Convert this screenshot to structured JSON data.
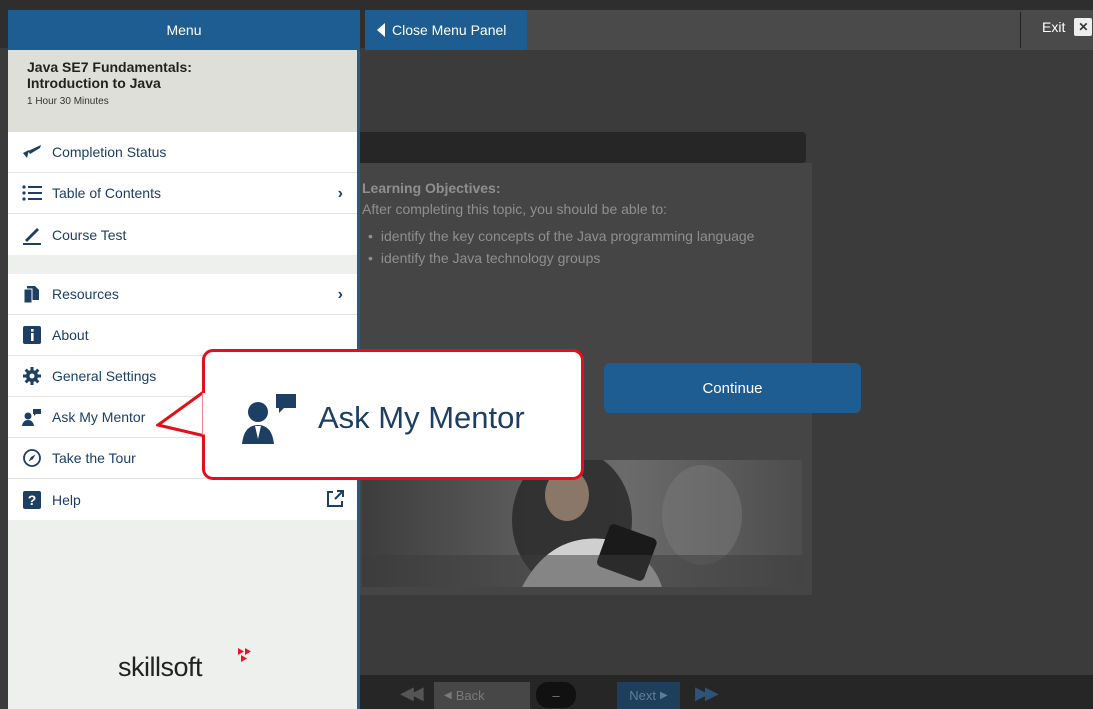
{
  "topbar": {
    "menu_title": "Menu",
    "close_panel_label": "Close Menu Panel",
    "exit_label": "Exit",
    "exit_icon": "close-icon"
  },
  "course": {
    "title_line1": "Java SE7 Fundamentals:",
    "title_line2": "Introduction to Java",
    "duration": "1 Hour 30 Minutes"
  },
  "menu": {
    "group1": [
      {
        "label": "Completion Status",
        "icon": "completion-check-icon"
      },
      {
        "label": "Table of Contents",
        "icon": "list-icon",
        "chevron": "›"
      },
      {
        "label": "Course Test",
        "icon": "pencil-icon"
      }
    ],
    "group2": [
      {
        "label": "Resources",
        "icon": "documents-icon",
        "chevron": "›"
      },
      {
        "label": "About",
        "icon": "info-icon"
      },
      {
        "label": "General Settings",
        "icon": "gear-icon"
      },
      {
        "label": "Ask My Mentor",
        "icon": "mentor-icon"
      },
      {
        "label": "Take the Tour",
        "icon": "compass-icon"
      },
      {
        "label": "Help",
        "icon": "help-icon",
        "external": true
      }
    ]
  },
  "logo": {
    "text": "skillsoft"
  },
  "callout": {
    "label": "Ask My Mentor"
  },
  "content": {
    "objectives_title": "Learning Objectives:",
    "objectives_intro": "After completing this topic, you should be able to:",
    "objectives": [
      "identify the key concepts of the Java programming language",
      "identify the Java technology groups"
    ],
    "continue_label": "Continue"
  },
  "nav": {
    "back_label": "Back",
    "page_indicator": "–",
    "next_label": "Next"
  },
  "colors": {
    "brand_blue": "#1e5d91",
    "callout_red": "#e30f1b",
    "menu_text": "#1c3f63",
    "logo_red": "#e0162b"
  }
}
